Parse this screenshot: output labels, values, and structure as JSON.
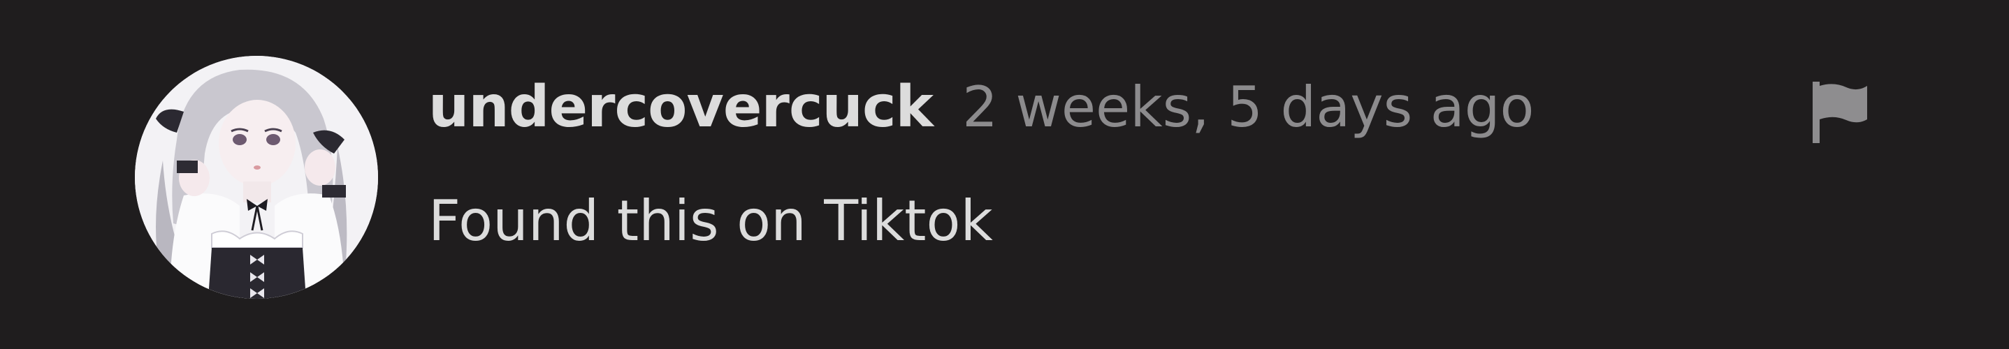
{
  "comment": {
    "username": "undercovercuck",
    "timestamp": "2 weeks, 5 days ago",
    "text": "Found this on Tiktok",
    "avatar_icon": "user-avatar-anime-girl",
    "flag_icon": "flag-icon"
  },
  "colors": {
    "background": "#1f1d1e",
    "username": "#dcdcdc",
    "timestamp": "#8c8b8d",
    "text": "#dcdcdc",
    "flag": "#8e8d8f"
  }
}
